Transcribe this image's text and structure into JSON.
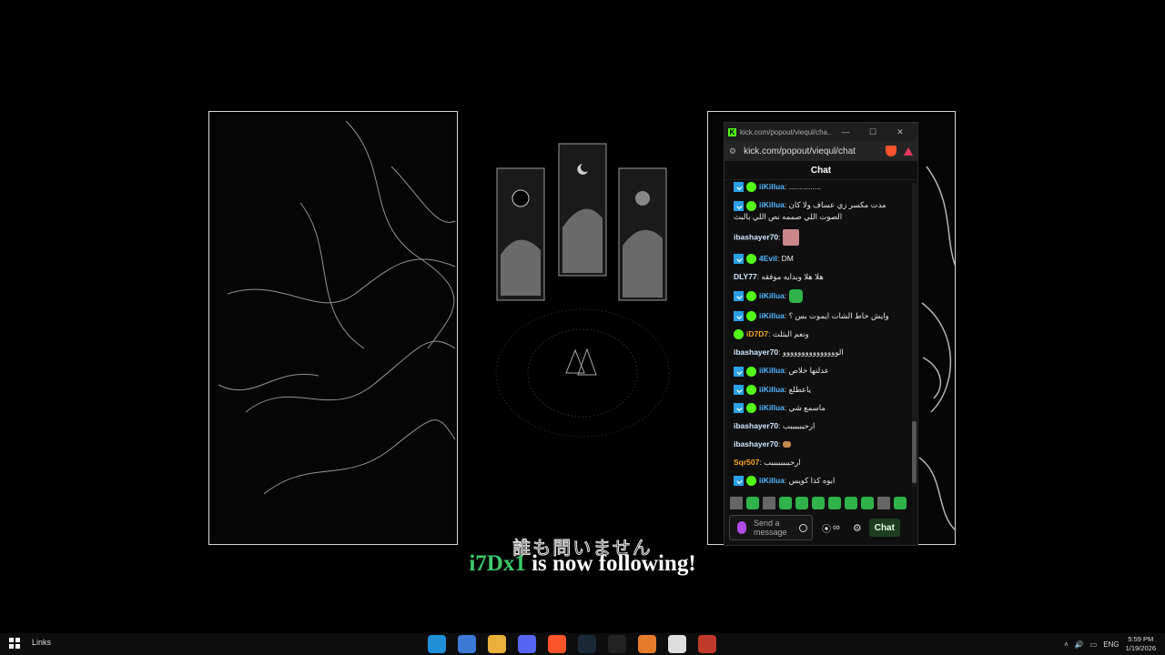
{
  "window": {
    "title_url": "kick.com/popout/viequl/cha...",
    "address_url": "kick.com/popout/viequl/chat",
    "chat_header": "Chat"
  },
  "messages": [
    {
      "user": "iiKillua",
      "text": ": ...............",
      "color": "#52b6ff",
      "badges": [
        "mod",
        "ver"
      ]
    },
    {
      "user": "iiKillua",
      "text": ": مدت مكسر زي عساف ولا كان الصوت اللي صممه نص اللي بالبث",
      "color": "#52b6ff",
      "badges": [
        "mod",
        "ver"
      ]
    },
    {
      "user": "ibashayer70",
      "text": ": ",
      "color": "#d0e8ff",
      "badges": [],
      "emote": "pink"
    },
    {
      "user": "4Evil",
      "text": ": DM",
      "color": "#52b6ff",
      "badges": [
        "mod",
        "ver"
      ]
    },
    {
      "user": "DLY77",
      "text": ": هلا هلا وبدايه موفقه",
      "color": "#d0e8ff",
      "badges": []
    },
    {
      "user": "iiKillua",
      "text": ": ",
      "color": "#52b6ff",
      "badges": [
        "mod",
        "ver"
      ],
      "emote": "green"
    },
    {
      "user": "iiKillua",
      "text": ": وايش حاط الشات ايموت بس ؟",
      "color": "#52b6ff",
      "badges": [
        "mod",
        "ver"
      ]
    },
    {
      "user": "iD7D7",
      "text": ": ونعم البثلث",
      "color": "#f5a623",
      "badges": [
        "ver"
      ]
    },
    {
      "user": "ibashayer70",
      "text": ": الووووووووووووووو",
      "color": "#d0e8ff",
      "badges": []
    },
    {
      "user": "iiKillua",
      "text": ": عدلتها خلاص",
      "color": "#52b6ff",
      "badges": [
        "mod",
        "ver"
      ]
    },
    {
      "user": "iiKillua",
      "text": ": ياعطلع",
      "color": "#52b6ff",
      "badges": [
        "mod",
        "ver"
      ]
    },
    {
      "user": "iiKillua",
      "text": ": ماسمع شي",
      "color": "#52b6ff",
      "badges": [
        "mod",
        "ver"
      ]
    },
    {
      "user": "ibashayer70",
      "text": ": ارحببببببب",
      "color": "#d0e8ff",
      "badges": []
    },
    {
      "user": "ibashayer70",
      "text": ": ",
      "color": "#d0e8ff",
      "badges": [],
      "emote": "small"
    },
    {
      "user": "Sqr507",
      "text": ": ارحببببببببب",
      "color": "#f5a623",
      "badges": []
    },
    {
      "user": "iiKillua",
      "text": ": ابوه كذا كويس",
      "color": "#52b6ff",
      "badges": [
        "mod",
        "ver"
      ]
    }
  ],
  "composer": {
    "placeholder_line1": "Send a",
    "placeholder_line2": "message",
    "points": "∞",
    "chat_button": "Chat"
  },
  "overlay": {
    "jp_subtitle": "誰も問いません",
    "follower": "i7Dx1",
    "follow_text": " is now following!"
  },
  "taskbar": {
    "links_label": "Links",
    "language": "ENG",
    "time": "5:59 PM",
    "date": "1/19/2026",
    "apps": [
      "edge-icon",
      "store-icon",
      "files-icon",
      "discord-icon",
      "brave-icon",
      "steam-icon",
      "g-hub-icon",
      "app-icon",
      "obs-icon",
      "chrome-icon"
    ],
    "app_colors": [
      "#1f8fd8",
      "#3b7bd5",
      "#e8b23a",
      "#5865f2",
      "#fb542b",
      "#1b2838",
      "#222222",
      "#e47c2c",
      "#dddddd",
      "#c0392b"
    ]
  }
}
